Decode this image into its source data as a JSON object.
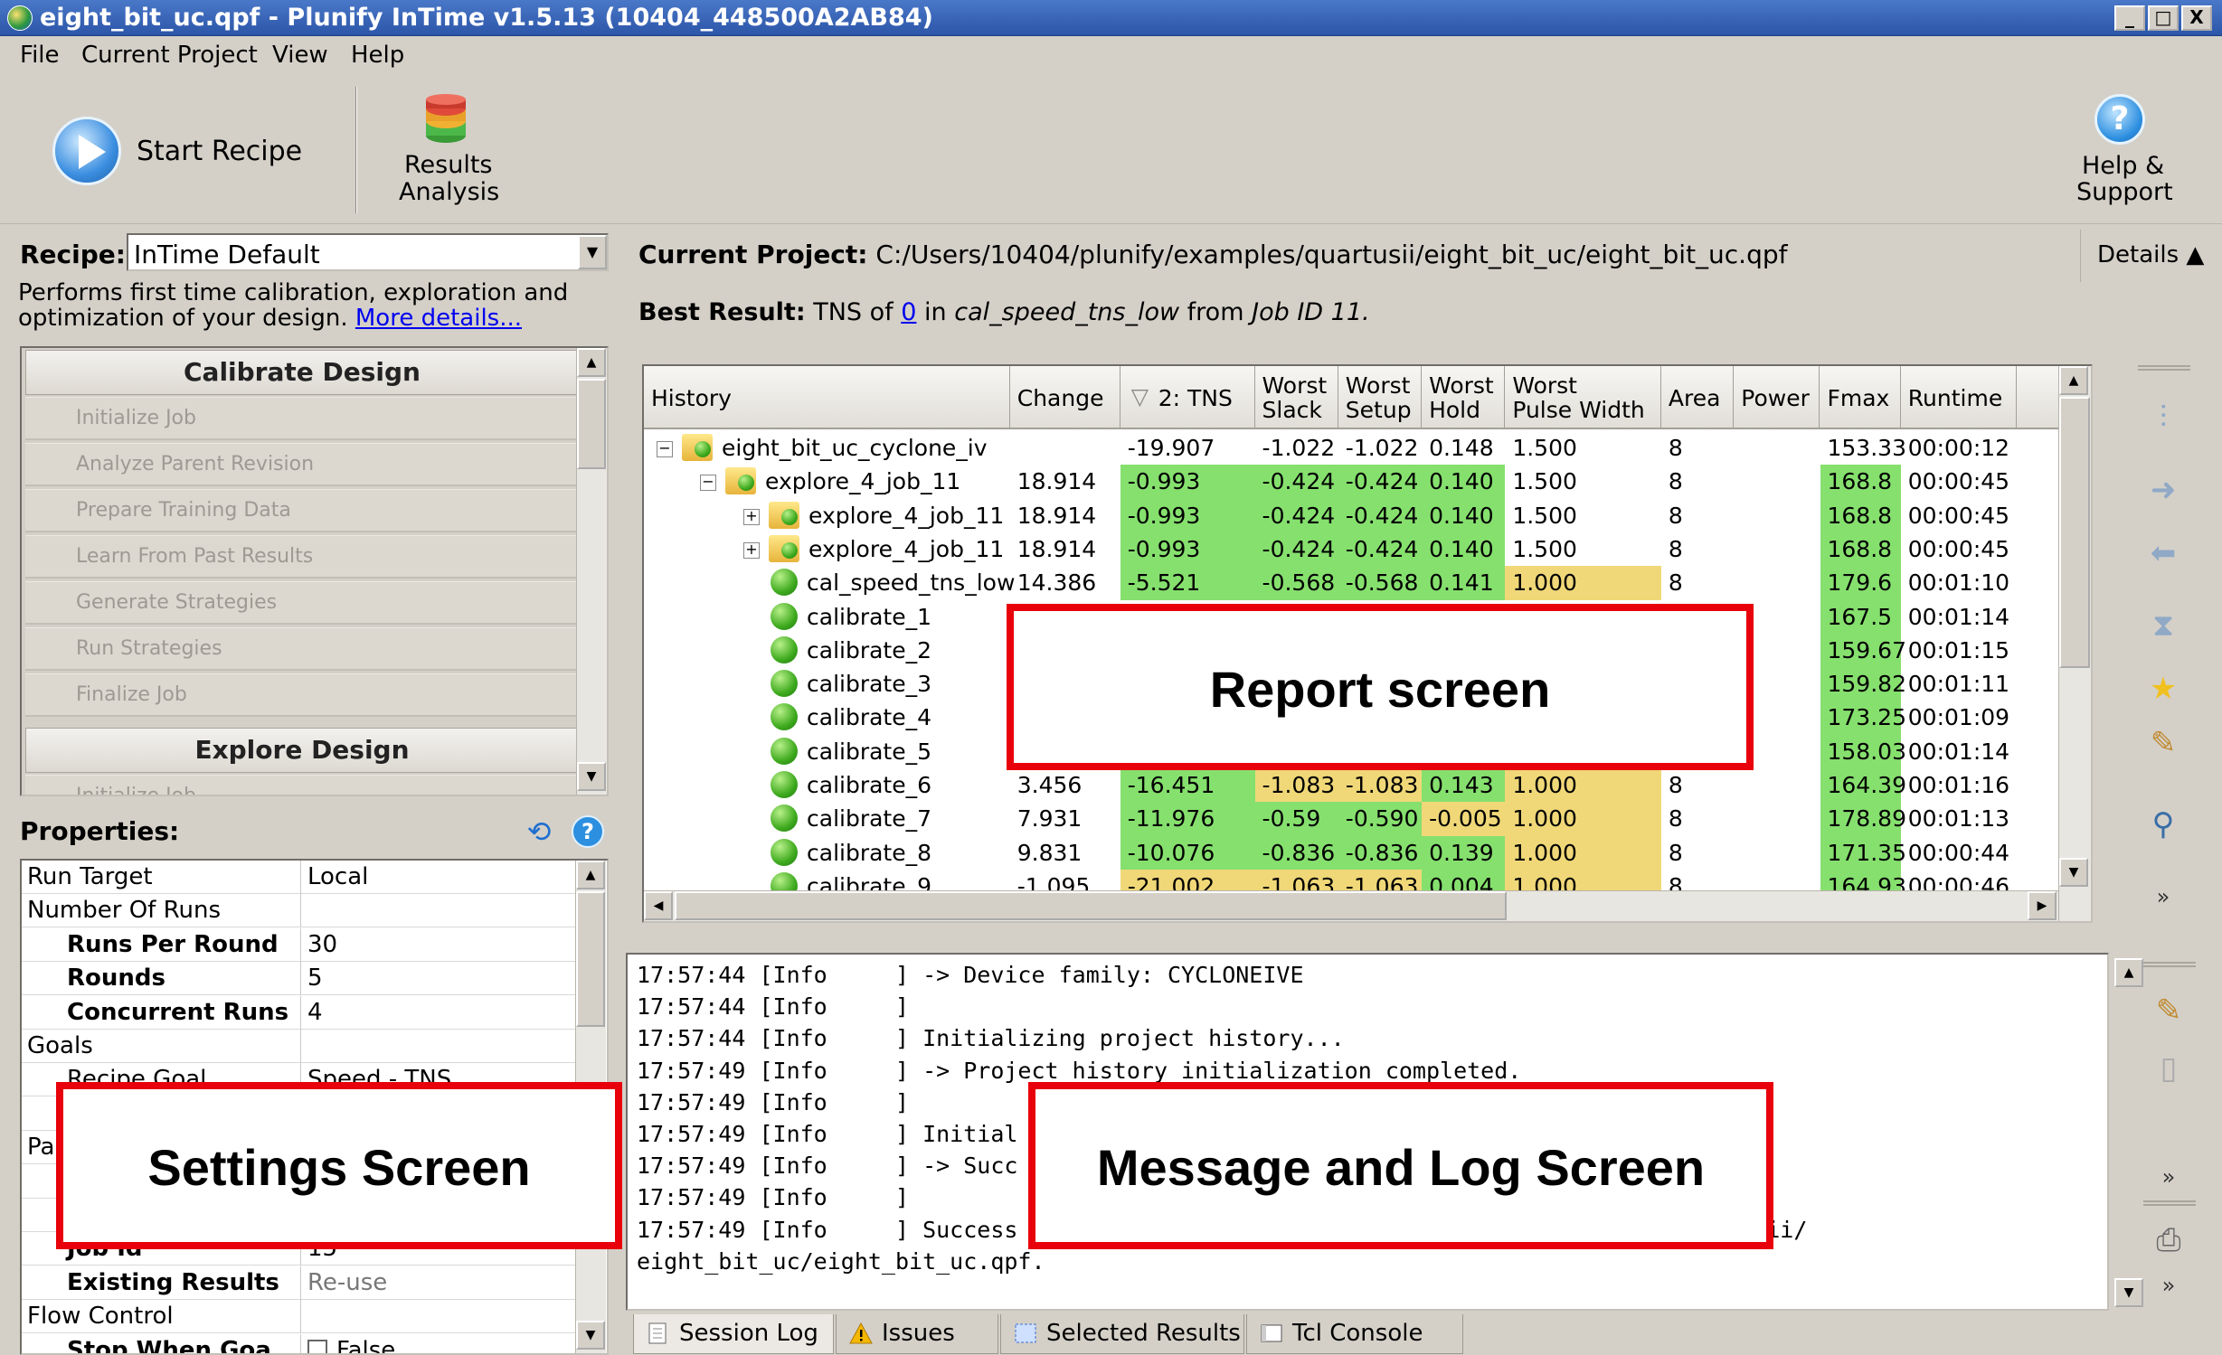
{
  "window": {
    "title": "eight_bit_uc.qpf - Plunify InTime v1.5.13 (10404_448500A2AB84)",
    "controls": [
      "_",
      "□",
      "X"
    ]
  },
  "menu": [
    "File",
    "Current Project",
    "View",
    "Help"
  ],
  "toolbar": {
    "start_recipe": "Start Recipe",
    "results_analysis_1": "Results",
    "results_analysis_2": "Analysis",
    "help_1": "Help &",
    "help_2": "Support"
  },
  "recipe": {
    "label": "Recipe:",
    "selected": "InTime Default",
    "desc_1": "Performs first time calibration, exploration and",
    "desc_2": "optimization of your design.",
    "more_details": "More details..."
  },
  "steps": {
    "calibrate_header": "Calibrate Design",
    "calibrate_items": [
      "Initialize Job",
      "Analyze Parent Revision",
      "Prepare Training Data",
      "Learn From Past Results",
      "Generate Strategies",
      "Run Strategies",
      "Finalize Job"
    ],
    "explore_header": "Explore Design",
    "explore_first_partial": "Initialize Job"
  },
  "properties": {
    "label": "Properties:",
    "rows": [
      {
        "key": "Run Target",
        "value": "Local",
        "indent": 0,
        "bold": false
      },
      {
        "key": "Number Of Runs",
        "value": "",
        "indent": 0,
        "bold": false
      },
      {
        "key": "Runs Per Round",
        "value": "30",
        "indent": 1,
        "bold": true
      },
      {
        "key": "Rounds",
        "value": "5",
        "indent": 1,
        "bold": true
      },
      {
        "key": "Concurrent Runs",
        "value": "4",
        "indent": 1,
        "bold": true
      },
      {
        "key": "Goals",
        "value": "",
        "indent": 0,
        "bold": false
      },
      {
        "key": "Recipe Goal",
        "value": "Speed - TNS",
        "indent": 1,
        "bold": false
      },
      {
        "key": "",
        "value": "",
        "indent": 0,
        "bold": false
      },
      {
        "key": "Pa",
        "value": "",
        "indent": 0,
        "bold": false
      },
      {
        "key": "",
        "value": "",
        "indent": 0,
        "bold": false
      },
      {
        "key": "",
        "value": "",
        "indent": 0,
        "bold": false
      },
      {
        "key": "Job Id",
        "value": "15",
        "indent": 1,
        "bold": true
      },
      {
        "key": "Existing Results",
        "value": "Re-use",
        "indent": 1,
        "bold": true,
        "grey": true
      },
      {
        "key": "Flow Control",
        "value": "",
        "indent": 0,
        "bold": false
      },
      {
        "key": "Stop When Goa...",
        "value": "False",
        "indent": 1,
        "bold": true,
        "checkbox": true
      }
    ]
  },
  "project": {
    "label": "Current Project:",
    "path": "C:/Users/10404/plunify/examples/quartusii/eight_bit_uc/eight_bit_uc.qpf",
    "details": "Details"
  },
  "best_result": {
    "label": "Best Result:",
    "text_1": "TNS of",
    "tns": "0",
    "text_2": "in",
    "strategy": "cal_speed_tns_low",
    "text_3": "from",
    "job": "Job ID 11."
  },
  "grid": {
    "columns": [
      {
        "l1": "History",
        "l2": ""
      },
      {
        "l1": "Change",
        "l2": ""
      },
      {
        "l1": "2: TNS",
        "l2": ""
      },
      {
        "l1": "Worst",
        "l2": "Slack"
      },
      {
        "l1": "Worst",
        "l2": "Setup"
      },
      {
        "l1": "Worst",
        "l2": "Hold"
      },
      {
        "l1": "Worst",
        "l2": "Pulse Width"
      },
      {
        "l1": "Area",
        "l2": ""
      },
      {
        "l1": "Power",
        "l2": ""
      },
      {
        "l1": "Fmax",
        "l2": ""
      },
      {
        "l1": "Runtime",
        "l2": ""
      }
    ],
    "rows": [
      {
        "name": "eight_bit_uc_cyclone_iv",
        "level": 0,
        "node": "folder",
        "exp": "-",
        "change": "",
        "tns": "-19.907",
        "slack": "-1.022",
        "setup": "-1.022",
        "hold": "0.148",
        "pulse": "1.500",
        "area": "8",
        "power": "",
        "fmax": "153.33",
        "runtime": "00:00:12",
        "tnsc": "",
        "slackc": "",
        "holdc": "",
        "pulsec": "",
        "fmaxc": ""
      },
      {
        "name": "explore_4_job_11",
        "level": 1,
        "node": "folder",
        "exp": "-",
        "change": "18.914",
        "tns": "-0.993",
        "slack": "-0.424",
        "setup": "-0.424",
        "hold": "0.140",
        "pulse": "1.500",
        "area": "8",
        "power": "",
        "fmax": "168.8",
        "runtime": "00:00:45",
        "tnsc": "#86e06e",
        "slackc": "#86e06e",
        "holdc": "#86e06e",
        "pulsec": "",
        "fmaxc": "#86e06e"
      },
      {
        "name": "explore_4_job_11",
        "level": 2,
        "node": "folder",
        "exp": "+",
        "change": "18.914",
        "tns": "-0.993",
        "slack": "-0.424",
        "setup": "-0.424",
        "hold": "0.140",
        "pulse": "1.500",
        "area": "8",
        "power": "",
        "fmax": "168.8",
        "runtime": "00:00:45",
        "tnsc": "#86e06e",
        "slackc": "#86e06e",
        "holdc": "#86e06e",
        "pulsec": "",
        "fmaxc": "#86e06e"
      },
      {
        "name": "explore_4_job_11",
        "level": 2,
        "node": "folder",
        "exp": "+",
        "change": "18.914",
        "tns": "-0.993",
        "slack": "-0.424",
        "setup": "-0.424",
        "hold": "0.140",
        "pulse": "1.500",
        "area": "8",
        "power": "",
        "fmax": "168.8",
        "runtime": "00:00:45",
        "tnsc": "#86e06e",
        "slackc": "#86e06e",
        "holdc": "#86e06e",
        "pulsec": "",
        "fmaxc": "#86e06e"
      },
      {
        "name": "cal_speed_tns_low",
        "level": 2,
        "node": "leaf",
        "exp": "",
        "change": "14.386",
        "tns": "-5.521",
        "slack": "-0.568",
        "setup": "-0.568",
        "hold": "0.141",
        "pulse": "1.000",
        "area": "8",
        "power": "",
        "fmax": "179.6",
        "runtime": "00:01:10",
        "tnsc": "#86e06e",
        "slackc": "#86e06e",
        "holdc": "#86e06e",
        "pulsec": "#f0d878",
        "fmaxc": "#86e06e"
      },
      {
        "name": "calibrate_1",
        "level": 2,
        "node": "leaf",
        "exp": "",
        "change": "",
        "tns": "",
        "slack": "",
        "setup": "",
        "hold": "",
        "pulse": "",
        "area": "",
        "power": "",
        "fmax": "167.5",
        "runtime": "00:01:14",
        "tnsc": "",
        "slackc": "",
        "holdc": "",
        "pulsec": "",
        "fmaxc": "#86e06e"
      },
      {
        "name": "calibrate_2",
        "level": 2,
        "node": "leaf",
        "exp": "",
        "change": "",
        "tns": "",
        "slack": "",
        "setup": "",
        "hold": "",
        "pulse": "",
        "area": "",
        "power": "",
        "fmax": "159.67",
        "runtime": "00:01:15",
        "tnsc": "",
        "slackc": "",
        "holdc": "",
        "pulsec": "",
        "fmaxc": "#86e06e"
      },
      {
        "name": "calibrate_3",
        "level": 2,
        "node": "leaf",
        "exp": "",
        "change": "",
        "tns": "",
        "slack": "",
        "setup": "",
        "hold": "",
        "pulse": "",
        "area": "",
        "power": "",
        "fmax": "159.82",
        "runtime": "00:01:11",
        "tnsc": "",
        "slackc": "",
        "holdc": "",
        "pulsec": "",
        "fmaxc": "#86e06e"
      },
      {
        "name": "calibrate_4",
        "level": 2,
        "node": "leaf",
        "exp": "",
        "change": "",
        "tns": "",
        "slack": "",
        "setup": "",
        "hold": "",
        "pulse": "",
        "area": "",
        "power": "",
        "fmax": "173.25",
        "runtime": "00:01:09",
        "tnsc": "",
        "slackc": "",
        "holdc": "",
        "pulsec": "",
        "fmaxc": "#86e06e"
      },
      {
        "name": "calibrate_5",
        "level": 2,
        "node": "leaf",
        "exp": "",
        "change": "",
        "tns": "",
        "slack": "",
        "setup": "",
        "hold": "",
        "pulse": "",
        "area": "",
        "power": "",
        "fmax": "158.03",
        "runtime": "00:01:14",
        "tnsc": "",
        "slackc": "",
        "holdc": "",
        "pulsec": "#f0d878",
        "fmaxc": "#86e06e"
      },
      {
        "name": "calibrate_6",
        "level": 2,
        "node": "leaf",
        "exp": "",
        "change": "3.456",
        "tns": "-16.451",
        "slack": "-1.083",
        "setup": "-1.083",
        "hold": "0.143",
        "pulse": "1.000",
        "area": "8",
        "power": "",
        "fmax": "164.39",
        "runtime": "00:01:16",
        "tnsc": "#86e06e",
        "slackc": "#f0d878",
        "holdc": "#86e06e",
        "pulsec": "#f0d878",
        "fmaxc": "#86e06e"
      },
      {
        "name": "calibrate_7",
        "level": 2,
        "node": "leaf",
        "exp": "",
        "change": "7.931",
        "tns": "-11.976",
        "slack": "-0.59",
        "setup": "-0.590",
        "hold": "-0.005",
        "pulse": "1.000",
        "area": "8",
        "power": "",
        "fmax": "178.89",
        "runtime": "00:01:13",
        "tnsc": "#86e06e",
        "slackc": "#86e06e",
        "holdc": "#f0d878",
        "pulsec": "#f0d878",
        "fmaxc": "#86e06e"
      },
      {
        "name": "calibrate_8",
        "level": 2,
        "node": "leaf",
        "exp": "",
        "change": "9.831",
        "tns": "-10.076",
        "slack": "-0.836",
        "setup": "-0.836",
        "hold": "0.139",
        "pulse": "1.000",
        "area": "8",
        "power": "",
        "fmax": "171.35",
        "runtime": "00:00:44",
        "tnsc": "#86e06e",
        "slackc": "#86e06e",
        "holdc": "#86e06e",
        "pulsec": "#f0d878",
        "fmaxc": "#86e06e"
      },
      {
        "name": "calibrate_9",
        "level": 2,
        "node": "leaf",
        "exp": "",
        "change": "-1.095",
        "tns": "-21.002",
        "slack": "-1.063",
        "setup": "-1.063",
        "hold": "0.004",
        "pulse": "1.000",
        "area": "8",
        "power": "",
        "fmax": "164.93",
        "runtime": "00:00:46",
        "tnsc": "#f0d878",
        "slackc": "#f0d878",
        "holdc": "#86e06e",
        "pulsec": "#f0d878",
        "fmaxc": "#86e06e"
      }
    ]
  },
  "log": {
    "lines": [
      "17:57:44 [Info     ] -> Device family: CYCLONEIVE",
      "17:57:44 [Info     ]",
      "17:57:44 [Info     ] Initializing project history...",
      "17:57:49 [Info     ] -> Project history initialization completed.",
      "17:57:49 [Info     ]",
      "17:57:49 [Info     ] Initial",
      "17:57:49 [Info     ] -> Succ                                              ).",
      "17:57:49 [Info     ]",
      "17:57:49 [Info     ] Success                                             es/quartusii/",
      "eight_bit_uc/eight_bit_uc.qpf."
    ]
  },
  "tabs": [
    "Session Log",
    "Issues",
    "Selected Results",
    "Tcl Console"
  ],
  "overlays": {
    "report": "Report screen",
    "settings": "Settings Screen",
    "message": "Message and Log Screen"
  },
  "colors": {
    "good": "#86e06e",
    "warn": "#f0d878",
    "highlight": "#e8000a"
  }
}
